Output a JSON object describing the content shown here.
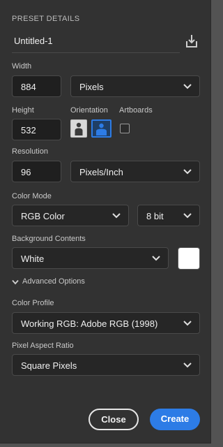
{
  "panel": {
    "heading": "PRESET DETAILS",
    "document_name": "Untitled-1",
    "save_icon": "download-tray-icon"
  },
  "width": {
    "label": "Width",
    "value": "884",
    "unit": "Pixels"
  },
  "height": {
    "label": "Height",
    "value": "532"
  },
  "orientation": {
    "label": "Orientation",
    "selected": "landscape"
  },
  "artboards": {
    "label": "Artboards",
    "checked": false
  },
  "resolution": {
    "label": "Resolution",
    "value": "96",
    "unit": "Pixels/Inch"
  },
  "color_mode": {
    "label": "Color Mode",
    "mode": "RGB Color",
    "depth": "8 bit"
  },
  "background": {
    "label": "Background Contents",
    "value": "White",
    "swatch_color": "#ffffff"
  },
  "advanced": {
    "label": "Advanced Options",
    "expanded": true
  },
  "color_profile": {
    "label": "Color Profile",
    "value": "Working RGB: Adobe RGB (1998)"
  },
  "pixel_aspect": {
    "label": "Pixel Aspect Ratio",
    "value": "Square Pixels"
  },
  "buttons": {
    "close": "Close",
    "create": "Create"
  },
  "colors": {
    "panel_bg": "#323232",
    "accent": "#2d7ce6",
    "selected_orientation": "#2d7ce6"
  }
}
